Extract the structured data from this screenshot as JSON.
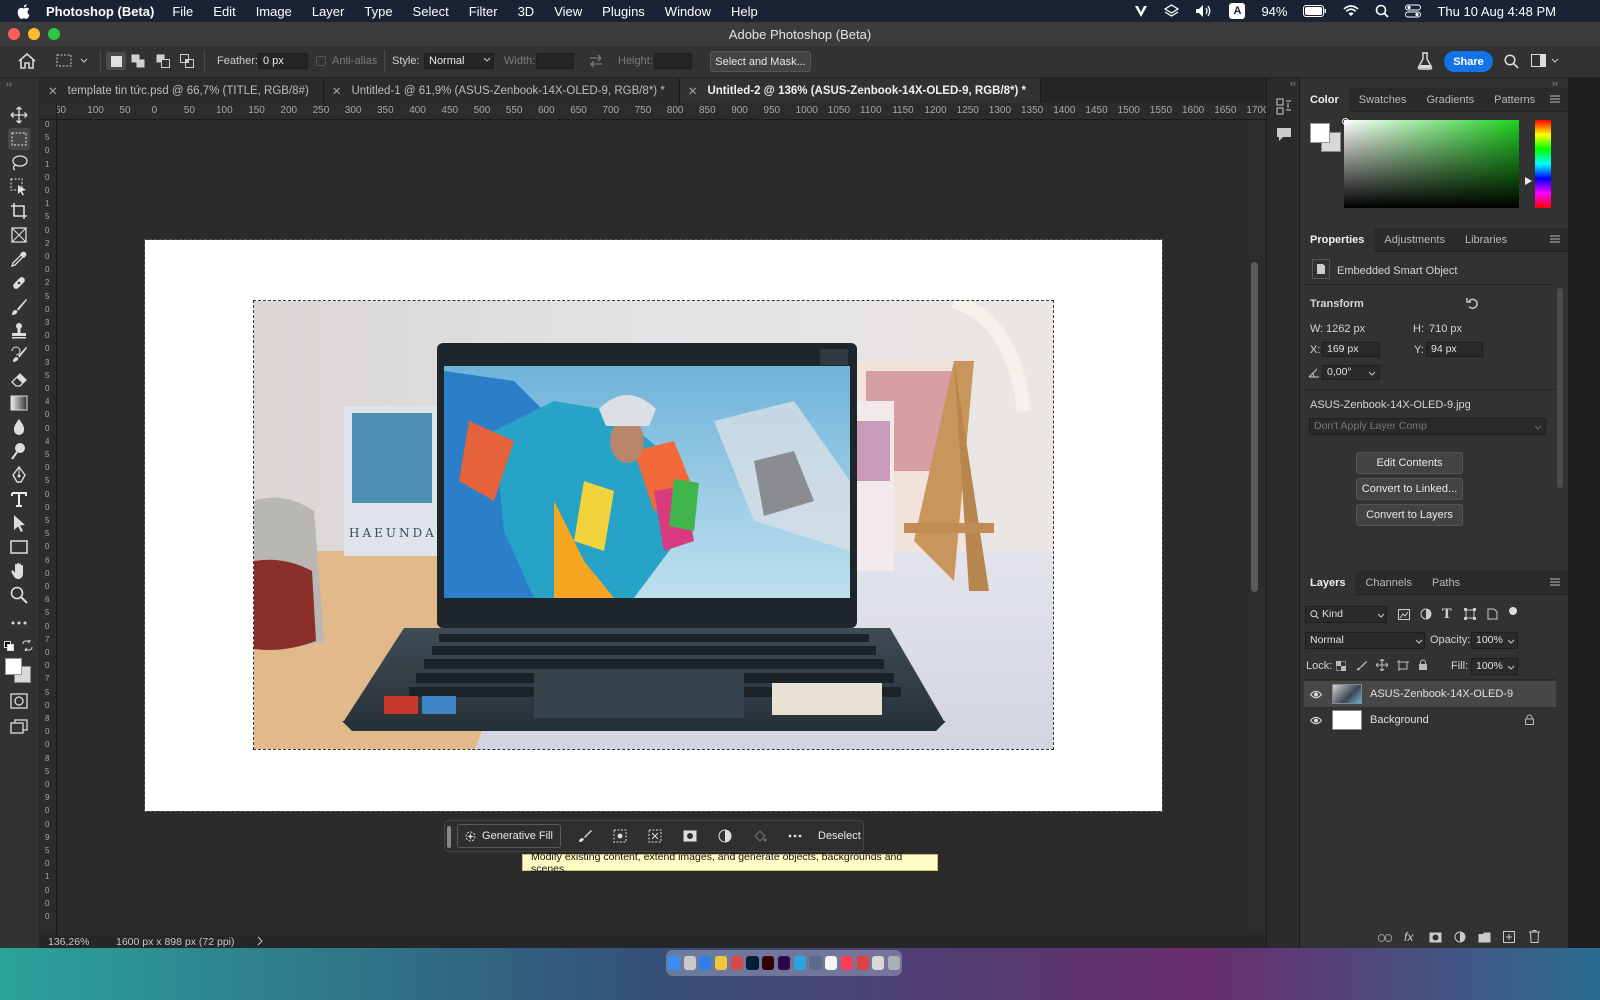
{
  "menubar": {
    "app_name": "Photoshop (Beta)",
    "menus": [
      "File",
      "Edit",
      "Image",
      "Layer",
      "Type",
      "Select",
      "Filter",
      "3D",
      "View",
      "Plugins",
      "Window",
      "Help"
    ],
    "battery": "94%",
    "clock": "Thu 10 Aug  4:48 PM",
    "input_badge": "A"
  },
  "window": {
    "title": "Adobe Photoshop (Beta)"
  },
  "options": {
    "feather_label": "Feather:",
    "feather_value": "0 px",
    "antialias_label": "Anti-alias",
    "style_label": "Style:",
    "style_value": "Normal",
    "width_label": "Width:",
    "height_label": "Height:",
    "select_mask_label": "Select and Mask...",
    "share_label": "Share"
  },
  "tabs": [
    {
      "label": "template tin tức.psd @ 66,7% (TITLE, RGB/8#)"
    },
    {
      "label": "Untitled-1 @ 61,9% (ASUS-Zenbook-14X-OLED-9, RGB/8*) *"
    },
    {
      "label": "Untitled-2 @ 136% (ASUS-Zenbook-14X-OLED-9, RGB/8*) *"
    }
  ],
  "ruler": {
    "h_ticks": [
      "50",
      "100",
      "50",
      "0",
      "50",
      "100",
      "150",
      "200",
      "250",
      "300",
      "350",
      "400",
      "450",
      "500",
      "550",
      "600",
      "650",
      "700",
      "750",
      "800",
      "850",
      "900",
      "950",
      "1000",
      "1050",
      "1100",
      "1150",
      "1200",
      "1250",
      "1300",
      "1350",
      "1400",
      "1450",
      "1500",
      "1550",
      "1600",
      "1650",
      "1700"
    ],
    "v_ticks": [
      "0",
      "5",
      "0",
      "1",
      "0",
      "0",
      "1",
      "5",
      "0",
      "2",
      "0",
      "0",
      "2",
      "5",
      "0",
      "3",
      "0",
      "0",
      "3",
      "5",
      "0",
      "4",
      "0",
      "0",
      "4",
      "5",
      "0",
      "5",
      "0",
      "0",
      "5",
      "5",
      "0",
      "6",
      "0",
      "0",
      "6",
      "5",
      "0",
      "7",
      "0",
      "0",
      "7",
      "5",
      "0",
      "8",
      "0",
      "0",
      "8",
      "5",
      "0",
      "9",
      "0",
      "0",
      "9",
      "5",
      "0",
      "1",
      "0",
      "0",
      "0"
    ]
  },
  "taskbar": {
    "generative_fill": "Generative Fill",
    "deselect": "Deselect",
    "tooltip": "Modify existing content, extend images, and generate objects, backgrounds and scenes."
  },
  "status": {
    "zoom": "136,26%",
    "doc_info": "1600 px x 898 px (72 ppi)"
  },
  "color_panel": {
    "tabs": [
      "Color",
      "Swatches",
      "Gradients",
      "Patterns"
    ],
    "active_tab": "Color"
  },
  "properties_panel": {
    "tabs": [
      "Properties",
      "Adjustments",
      "Libraries"
    ],
    "object_type": "Embedded Smart Object",
    "transform_label": "Transform",
    "w_label": "W:",
    "w_value": "1262 px",
    "h_label": "H:",
    "h_value": "710 px",
    "x_label": "X:",
    "x_value": "169 px",
    "y_label": "Y:",
    "y_value": "94 px",
    "angle_value": "0,00°",
    "filename": "ASUS-Zenbook-14X-OLED-9.jpg",
    "layer_comp": "Don't Apply Layer Comp",
    "buttons": [
      "Edit Contents",
      "Convert to Linked...",
      "Convert to Layers"
    ]
  },
  "layers_panel": {
    "tabs": [
      "Layers",
      "Channels",
      "Paths"
    ],
    "filter_kind": "Kind",
    "blend_mode": "Normal",
    "opacity_label": "Opacity:",
    "opacity_value": "100%",
    "lock_label": "Lock:",
    "fill_label": "Fill:",
    "fill_value": "100%",
    "layers": [
      {
        "name": "ASUS-Zenbook-14X-OLED-9",
        "selected": true
      },
      {
        "name": "Background",
        "selected": false
      }
    ]
  },
  "colors": {
    "accent": "#1473e6",
    "foreground_swatch": "#ffffff",
    "tooltip_bg": "#fefbc4"
  }
}
